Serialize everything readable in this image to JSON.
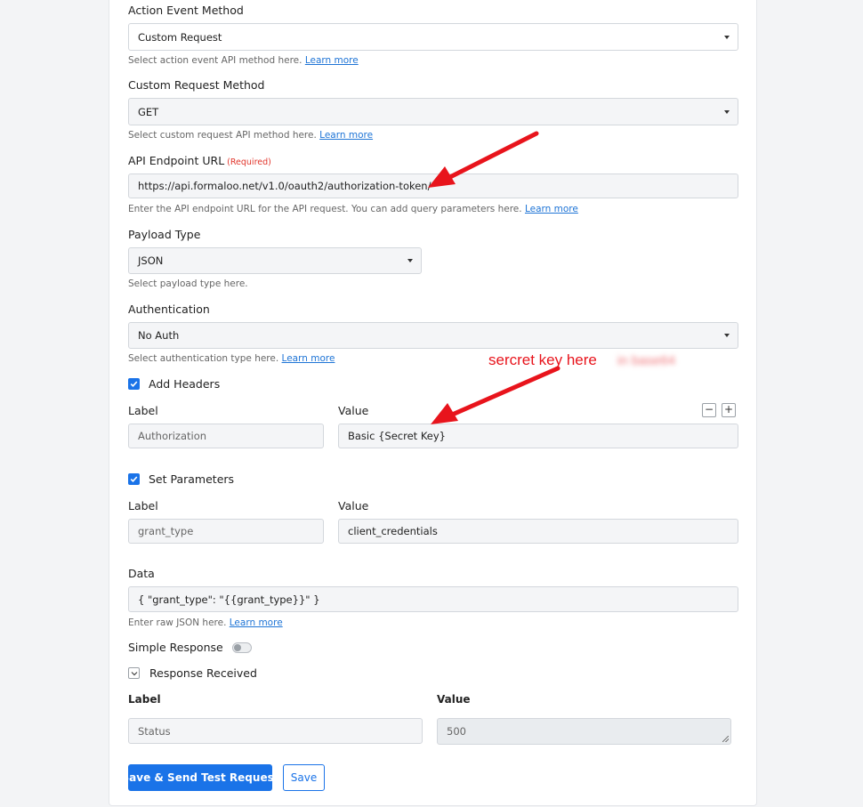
{
  "action_event_method": {
    "label": "Action Event Method",
    "value": "Custom Request",
    "help": "Select action event API method here.",
    "help_link": "Learn more"
  },
  "custom_request_method": {
    "label": "Custom Request Method",
    "value": "GET",
    "help": "Select custom request API method here.",
    "help_link": "Learn more"
  },
  "api_endpoint": {
    "label": "API Endpoint URL",
    "required": "(Required)",
    "value": "https://api.formaloo.net/v1.0/oauth2/authorization-token/",
    "help": "Enter the API endpoint URL for the API request. You can add query parameters here.",
    "help_link": "Learn more"
  },
  "payload_type": {
    "label": "Payload Type",
    "value": "JSON",
    "help": "Select payload type here."
  },
  "authentication": {
    "label": "Authentication",
    "value": "No Auth",
    "help": "Select authentication type here.",
    "help_link": "Learn more"
  },
  "annotation": {
    "text": "sercret key here",
    "color": "#e8141c"
  },
  "headers": {
    "checkbox_label": "Add Headers",
    "checked": true,
    "label_col": "Label",
    "value_col": "Value",
    "minus": "−",
    "plus": "+",
    "row_label": "Authorization",
    "row_value": "Basic {Secret Key}"
  },
  "parameters": {
    "checkbox_label": "Set Parameters",
    "checked": true,
    "label_col": "Label",
    "value_col": "Value",
    "row_label": "grant_type",
    "row_value": "client_credentials"
  },
  "data_field": {
    "label": "Data",
    "value": "{ \"grant_type\": \"{{grant_type}}\" }",
    "help": "Enter raw JSON here.",
    "help_link": "Learn more"
  },
  "simple_response": {
    "label": "Simple Response",
    "enabled": false
  },
  "response_received": {
    "label": "Response Received",
    "label_col": "Label",
    "value_col": "Value",
    "row_label": "Status",
    "row_value": "500"
  },
  "buttons": {
    "save_send": "Save & Send Test Request",
    "save": "Save"
  },
  "colors": {
    "primary": "#1a73e8",
    "annotation_red": "#e8141c",
    "required_red": "#e1342a"
  }
}
